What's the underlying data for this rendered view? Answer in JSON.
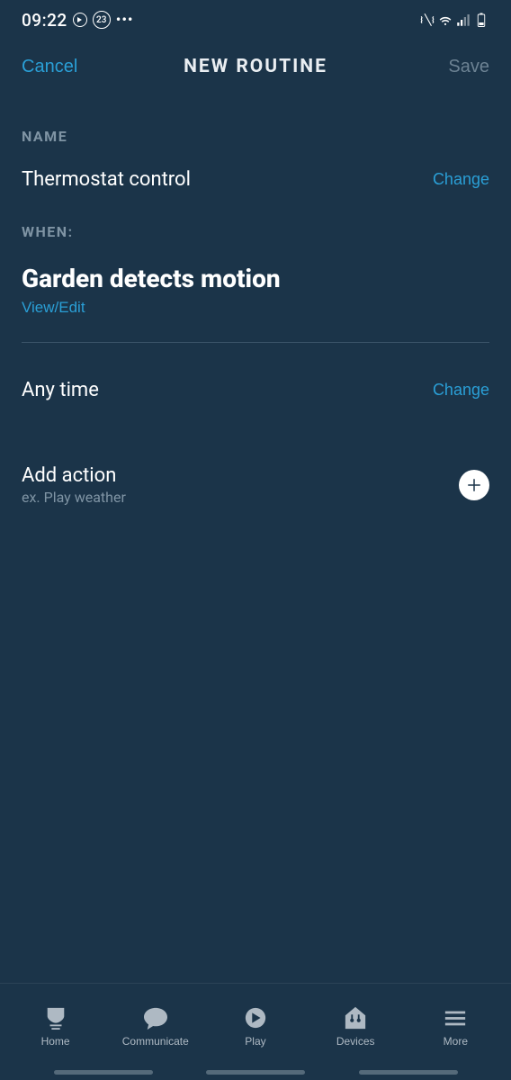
{
  "status_bar": {
    "time": "09:22",
    "badge": "23"
  },
  "header": {
    "cancel": "Cancel",
    "title": "NEW ROUTINE",
    "save": "Save"
  },
  "sections": {
    "name_label": "NAME",
    "name_value": "Thermostat control",
    "name_change": "Change",
    "when_label": "WHEN:",
    "trigger": "Garden detects motion",
    "view_edit": "View/Edit",
    "time_value": "Any time",
    "time_change": "Change",
    "add_action_title": "Add action",
    "add_action_hint": "ex. Play weather"
  },
  "nav": {
    "home": "Home",
    "communicate": "Communicate",
    "play": "Play",
    "devices": "Devices",
    "more": "More"
  }
}
